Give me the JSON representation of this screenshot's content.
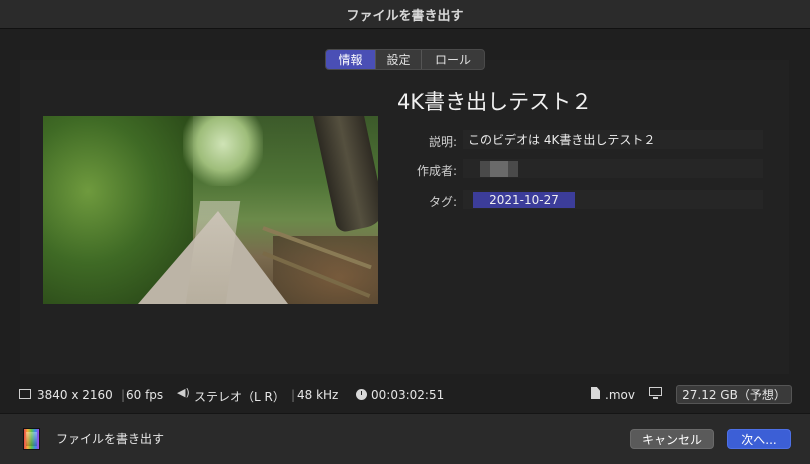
{
  "window": {
    "title": "ファイルを書き出す"
  },
  "tabs": [
    {
      "label": "情報",
      "active": true
    },
    {
      "label": "設定",
      "active": false
    },
    {
      "label": "ロール",
      "active": false
    }
  ],
  "project": {
    "title": "4K書き出しテスト２",
    "fields": {
      "description_label": "説明:",
      "description_value": "このビデオは 4K書き出しテスト２",
      "creator_label": "作成者:",
      "tags_label": "タグ:",
      "tag_value": "2021-10-27"
    }
  },
  "info": {
    "resolution": "3840 x 2160",
    "fps": "60 fps",
    "audio": "ステレオ（L R）",
    "sample_rate": "48 kHz",
    "duration": "00:03:02:51",
    "extension": ".mov",
    "size": "27.12 GB（予想）"
  },
  "footer": {
    "label": "ファイルを書き出す",
    "cancel": "キャンセル",
    "next": "次へ..."
  },
  "colors": {
    "accent": "#4a4fb5",
    "primary_button": "#3c5fd6",
    "tag_chip": "#3c3d9a"
  }
}
